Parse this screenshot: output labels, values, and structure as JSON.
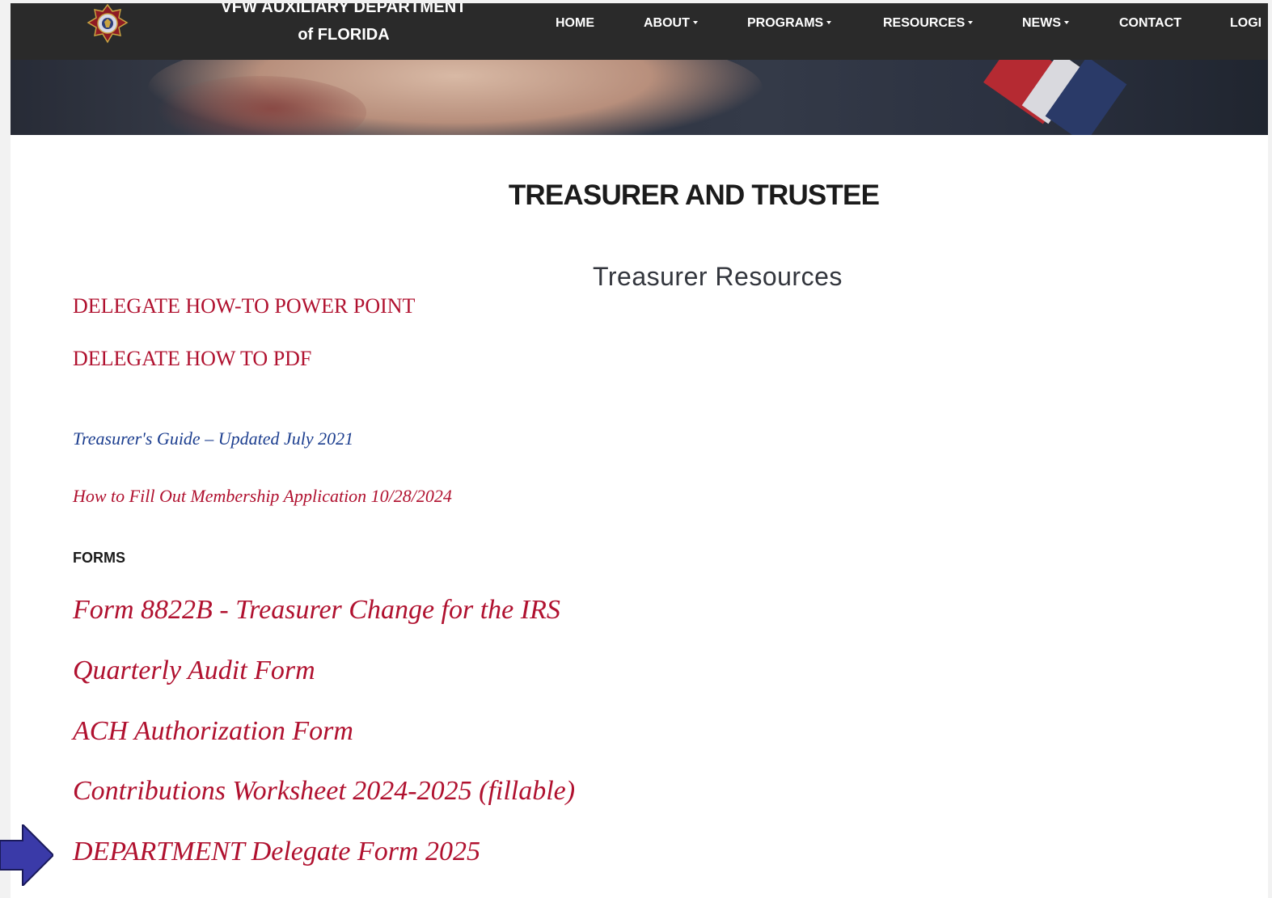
{
  "navbar": {
    "brand_line1": "VFW AUXILIARY DEPARTMENT",
    "brand_line2": "of FLORIDA",
    "logo_icon": "vfw-auxiliary-emblem",
    "items": [
      {
        "label": "HOME",
        "has_dropdown": false
      },
      {
        "label": "ABOUT",
        "has_dropdown": true
      },
      {
        "label": "PROGRAMS",
        "has_dropdown": true
      },
      {
        "label": "RESOURCES",
        "has_dropdown": true
      },
      {
        "label": "NEWS",
        "has_dropdown": true
      },
      {
        "label": "CONTACT",
        "has_dropdown": false
      },
      {
        "label": "LOGI",
        "has_dropdown": false
      }
    ]
  },
  "main": {
    "page_title": "TREASURER AND TRUSTEE",
    "section_title": "Treasurer Resources",
    "resource_links": [
      {
        "label": "DELEGATE HOW-TO POWER POINT"
      },
      {
        "label": "DELEGATE HOW TO PDF"
      },
      {
        "label": "Treasurer's Guide – Updated July 2021"
      },
      {
        "label": "How to Fill Out Membership Application 10/28/2024"
      }
    ],
    "forms_heading": "FORMS",
    "form_links": [
      {
        "label": "Form 8822B - Treasurer Change for the IRS"
      },
      {
        "label": "Quarterly Audit Form"
      },
      {
        "label": "ACH Authorization Form"
      },
      {
        "label": "Contributions Worksheet 2024-2025 (fillable)"
      },
      {
        "label": "DEPARTMENT Delegate Form 2025"
      }
    ]
  },
  "annotation": {
    "arrow_icon": "right-arrow-icon",
    "arrow_color": "#3a3aa8"
  },
  "colors": {
    "navbar_bg": "#2a2a2a",
    "link_red": "#b0112f",
    "link_blue": "#1c3e8f",
    "title_text": "#1b1b1b"
  }
}
